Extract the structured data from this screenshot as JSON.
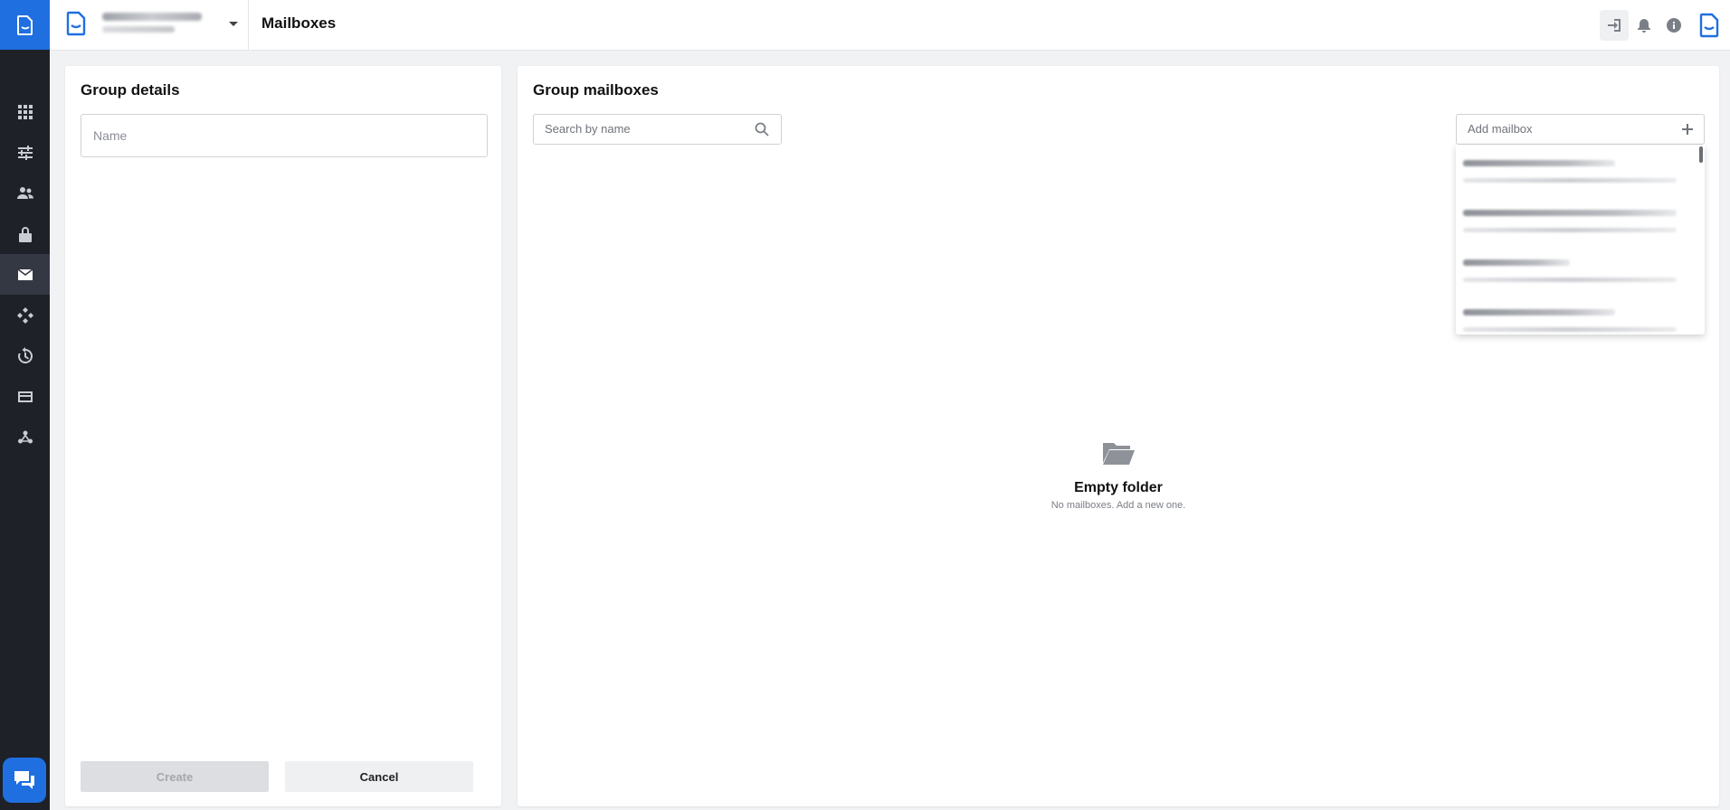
{
  "app": {
    "page_title": "Mailboxes"
  },
  "rail": {
    "items": [
      {
        "icon": "apps-grid-icon"
      },
      {
        "icon": "sliders-icon"
      },
      {
        "icon": "users-icon"
      },
      {
        "icon": "lock-icon"
      },
      {
        "icon": "mail-icon",
        "active": true
      },
      {
        "icon": "network-icon"
      },
      {
        "icon": "history-icon"
      },
      {
        "icon": "credit-card-icon"
      },
      {
        "icon": "webhook-icon"
      }
    ],
    "accent": "#1f6fe0",
    "background": "#1e2127"
  },
  "group_details": {
    "title": "Group details",
    "name_placeholder": "Name",
    "create_label": "Create",
    "cancel_label": "Cancel"
  },
  "group_mailboxes": {
    "title": "Group mailboxes",
    "search_placeholder": "Search by name",
    "add_placeholder": "Add mailbox",
    "empty_title": "Empty folder",
    "empty_subtitle": "No mailboxes. Add a new one."
  }
}
